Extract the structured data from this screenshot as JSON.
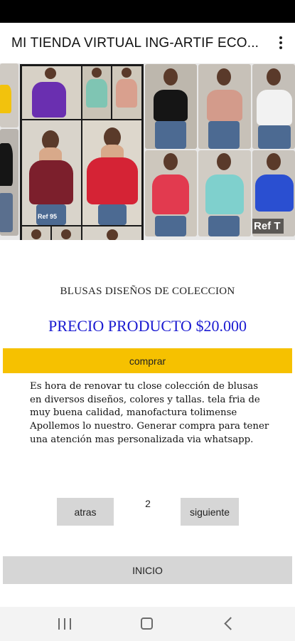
{
  "app_bar": {
    "title": "MI TIENDA VIRTUAL ING-ARTIF ECO...",
    "menu_icon": "overflow-menu-icon"
  },
  "gallery": {
    "ref_labels": [
      "Ref 95",
      "Ref T"
    ],
    "colors": {
      "purple": "#6a2fb0",
      "mint": "#7fc5b3",
      "blush": "#d9a08e",
      "wine": "#7c1f2c",
      "red": "#d52335",
      "black": "#151515",
      "yellow": "#f2c20d",
      "white": "#f2f2f2",
      "pink_red": "#e23a4f",
      "aqua": "#7fd0cd",
      "royal_blue": "#2a4fd1",
      "rose": "#d39b8b"
    }
  },
  "product": {
    "title": "BLUSAS DISEÑOS DE COLECCION",
    "price": "PRECIO PRODUCTO $20.000",
    "buy_label": "comprar",
    "description": "Es hora de renovar tu close colección de blusas en diversos diseños, colores y tallas. tela fria de muy buena calidad, manofactura tolimense Apollemos lo nuestro. Generar compra para tener una atención mas personalizada via whatsapp."
  },
  "pagination": {
    "prev_label": "atras",
    "page": "2",
    "next_label": "siguiente"
  },
  "home_label": "INICIO",
  "colors": {
    "accent_button": "#f6c100",
    "price_text": "#1a1ad1",
    "neutral_button": "#d6d6d6"
  },
  "nav": {
    "recents_icon": "recents-icon",
    "home_icon": "home-icon",
    "back_icon": "back-icon"
  }
}
